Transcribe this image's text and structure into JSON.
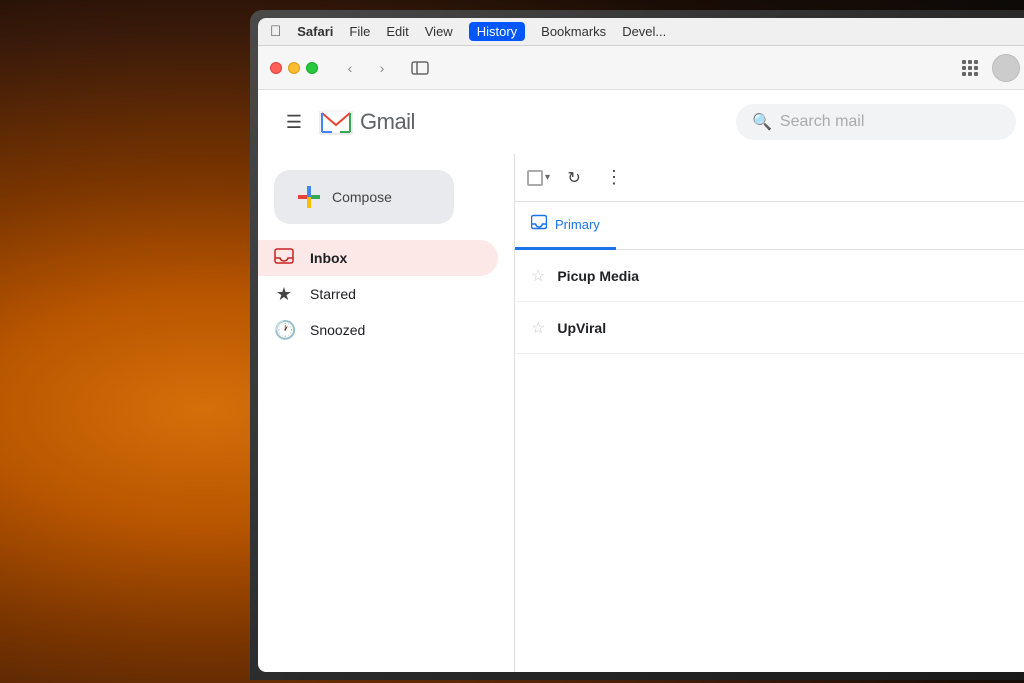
{
  "background": {
    "description": "warm bokeh light background"
  },
  "menubar": {
    "apple_symbol": "&#63743;",
    "items": [
      {
        "label": "Safari",
        "bold": true
      },
      {
        "label": "File"
      },
      {
        "label": "Edit"
      },
      {
        "label": "View"
      },
      {
        "label": "History",
        "highlighted": true
      },
      {
        "label": "Bookmarks"
      },
      {
        "label": "Devel..."
      }
    ]
  },
  "safari_toolbar": {
    "back_label": "‹",
    "forward_label": "›",
    "sidebar_label": "⬜",
    "grid_label": "⠿"
  },
  "gmail": {
    "menu_icon": "☰",
    "logo_text": "Gmail",
    "search_placeholder": "Search mail",
    "compose_label": "Compose",
    "nav_items": [
      {
        "id": "inbox",
        "label": "Inbox",
        "icon": "▣",
        "active": true
      },
      {
        "id": "starred",
        "label": "Starred",
        "icon": "★",
        "active": false
      },
      {
        "id": "snoozed",
        "label": "Snoozed",
        "icon": "🕐",
        "active": false
      }
    ],
    "tabs": [
      {
        "id": "primary",
        "label": "Primary",
        "icon": "▣",
        "active": true
      }
    ],
    "emails": [
      {
        "sender": "Picup Media",
        "subject": "",
        "starred": false
      },
      {
        "sender": "UpViral",
        "subject": "",
        "starred": false
      }
    ]
  }
}
